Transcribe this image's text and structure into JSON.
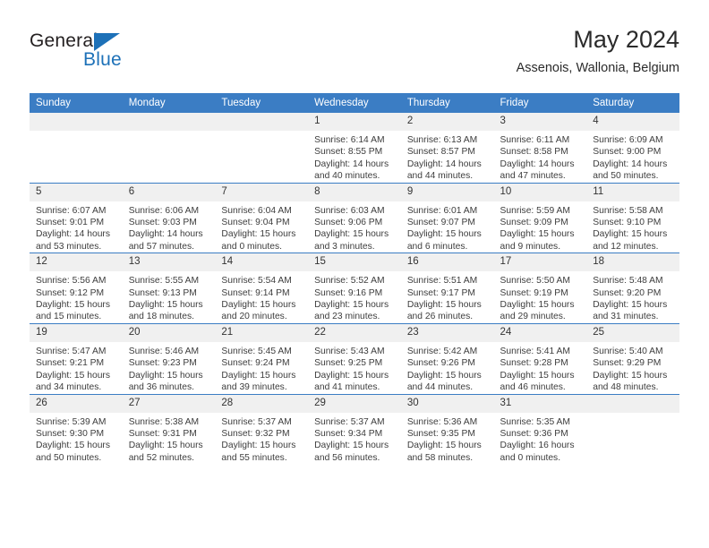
{
  "brand": {
    "line1": "General",
    "line2": "Blue",
    "triangle_color": "#1d71b8"
  },
  "header": {
    "title": "May 2024",
    "subtitle": "Assenois, Wallonia, Belgium",
    "accent_color": "#3b7dc4"
  },
  "weekday_headers": [
    "Sunday",
    "Monday",
    "Tuesday",
    "Wednesday",
    "Thursday",
    "Friday",
    "Saturday"
  ],
  "labels": {
    "sunrise": "Sunrise:",
    "sunset": "Sunset:",
    "daylight": "Daylight:"
  },
  "weeks": [
    [
      {
        "day": "",
        "empty": true
      },
      {
        "day": "",
        "empty": true
      },
      {
        "day": "",
        "empty": true
      },
      {
        "day": "1",
        "sunrise": "Sunrise: 6:14 AM",
        "sunset": "Sunset: 8:55 PM",
        "daylight": "Daylight: 14 hours and 40 minutes."
      },
      {
        "day": "2",
        "sunrise": "Sunrise: 6:13 AM",
        "sunset": "Sunset: 8:57 PM",
        "daylight": "Daylight: 14 hours and 44 minutes."
      },
      {
        "day": "3",
        "sunrise": "Sunrise: 6:11 AM",
        "sunset": "Sunset: 8:58 PM",
        "daylight": "Daylight: 14 hours and 47 minutes."
      },
      {
        "day": "4",
        "sunrise": "Sunrise: 6:09 AM",
        "sunset": "Sunset: 9:00 PM",
        "daylight": "Daylight: 14 hours and 50 minutes."
      }
    ],
    [
      {
        "day": "5",
        "sunrise": "Sunrise: 6:07 AM",
        "sunset": "Sunset: 9:01 PM",
        "daylight": "Daylight: 14 hours and 53 minutes."
      },
      {
        "day": "6",
        "sunrise": "Sunrise: 6:06 AM",
        "sunset": "Sunset: 9:03 PM",
        "daylight": "Daylight: 14 hours and 57 minutes."
      },
      {
        "day": "7",
        "sunrise": "Sunrise: 6:04 AM",
        "sunset": "Sunset: 9:04 PM",
        "daylight": "Daylight: 15 hours and 0 minutes."
      },
      {
        "day": "8",
        "sunrise": "Sunrise: 6:03 AM",
        "sunset": "Sunset: 9:06 PM",
        "daylight": "Daylight: 15 hours and 3 minutes."
      },
      {
        "day": "9",
        "sunrise": "Sunrise: 6:01 AM",
        "sunset": "Sunset: 9:07 PM",
        "daylight": "Daylight: 15 hours and 6 minutes."
      },
      {
        "day": "10",
        "sunrise": "Sunrise: 5:59 AM",
        "sunset": "Sunset: 9:09 PM",
        "daylight": "Daylight: 15 hours and 9 minutes."
      },
      {
        "day": "11",
        "sunrise": "Sunrise: 5:58 AM",
        "sunset": "Sunset: 9:10 PM",
        "daylight": "Daylight: 15 hours and 12 minutes."
      }
    ],
    [
      {
        "day": "12",
        "sunrise": "Sunrise: 5:56 AM",
        "sunset": "Sunset: 9:12 PM",
        "daylight": "Daylight: 15 hours and 15 minutes."
      },
      {
        "day": "13",
        "sunrise": "Sunrise: 5:55 AM",
        "sunset": "Sunset: 9:13 PM",
        "daylight": "Daylight: 15 hours and 18 minutes."
      },
      {
        "day": "14",
        "sunrise": "Sunrise: 5:54 AM",
        "sunset": "Sunset: 9:14 PM",
        "daylight": "Daylight: 15 hours and 20 minutes."
      },
      {
        "day": "15",
        "sunrise": "Sunrise: 5:52 AM",
        "sunset": "Sunset: 9:16 PM",
        "daylight": "Daylight: 15 hours and 23 minutes."
      },
      {
        "day": "16",
        "sunrise": "Sunrise: 5:51 AM",
        "sunset": "Sunset: 9:17 PM",
        "daylight": "Daylight: 15 hours and 26 minutes."
      },
      {
        "day": "17",
        "sunrise": "Sunrise: 5:50 AM",
        "sunset": "Sunset: 9:19 PM",
        "daylight": "Daylight: 15 hours and 29 minutes."
      },
      {
        "day": "18",
        "sunrise": "Sunrise: 5:48 AM",
        "sunset": "Sunset: 9:20 PM",
        "daylight": "Daylight: 15 hours and 31 minutes."
      }
    ],
    [
      {
        "day": "19",
        "sunrise": "Sunrise: 5:47 AM",
        "sunset": "Sunset: 9:21 PM",
        "daylight": "Daylight: 15 hours and 34 minutes."
      },
      {
        "day": "20",
        "sunrise": "Sunrise: 5:46 AM",
        "sunset": "Sunset: 9:23 PM",
        "daylight": "Daylight: 15 hours and 36 minutes."
      },
      {
        "day": "21",
        "sunrise": "Sunrise: 5:45 AM",
        "sunset": "Sunset: 9:24 PM",
        "daylight": "Daylight: 15 hours and 39 minutes."
      },
      {
        "day": "22",
        "sunrise": "Sunrise: 5:43 AM",
        "sunset": "Sunset: 9:25 PM",
        "daylight": "Daylight: 15 hours and 41 minutes."
      },
      {
        "day": "23",
        "sunrise": "Sunrise: 5:42 AM",
        "sunset": "Sunset: 9:26 PM",
        "daylight": "Daylight: 15 hours and 44 minutes."
      },
      {
        "day": "24",
        "sunrise": "Sunrise: 5:41 AM",
        "sunset": "Sunset: 9:28 PM",
        "daylight": "Daylight: 15 hours and 46 minutes."
      },
      {
        "day": "25",
        "sunrise": "Sunrise: 5:40 AM",
        "sunset": "Sunset: 9:29 PM",
        "daylight": "Daylight: 15 hours and 48 minutes."
      }
    ],
    [
      {
        "day": "26",
        "sunrise": "Sunrise: 5:39 AM",
        "sunset": "Sunset: 9:30 PM",
        "daylight": "Daylight: 15 hours and 50 minutes."
      },
      {
        "day": "27",
        "sunrise": "Sunrise: 5:38 AM",
        "sunset": "Sunset: 9:31 PM",
        "daylight": "Daylight: 15 hours and 52 minutes."
      },
      {
        "day": "28",
        "sunrise": "Sunrise: 5:37 AM",
        "sunset": "Sunset: 9:32 PM",
        "daylight": "Daylight: 15 hours and 55 minutes."
      },
      {
        "day": "29",
        "sunrise": "Sunrise: 5:37 AM",
        "sunset": "Sunset: 9:34 PM",
        "daylight": "Daylight: 15 hours and 56 minutes."
      },
      {
        "day": "30",
        "sunrise": "Sunrise: 5:36 AM",
        "sunset": "Sunset: 9:35 PM",
        "daylight": "Daylight: 15 hours and 58 minutes."
      },
      {
        "day": "31",
        "sunrise": "Sunrise: 5:35 AM",
        "sunset": "Sunset: 9:36 PM",
        "daylight": "Daylight: 16 hours and 0 minutes."
      },
      {
        "day": "",
        "empty": true
      }
    ]
  ]
}
